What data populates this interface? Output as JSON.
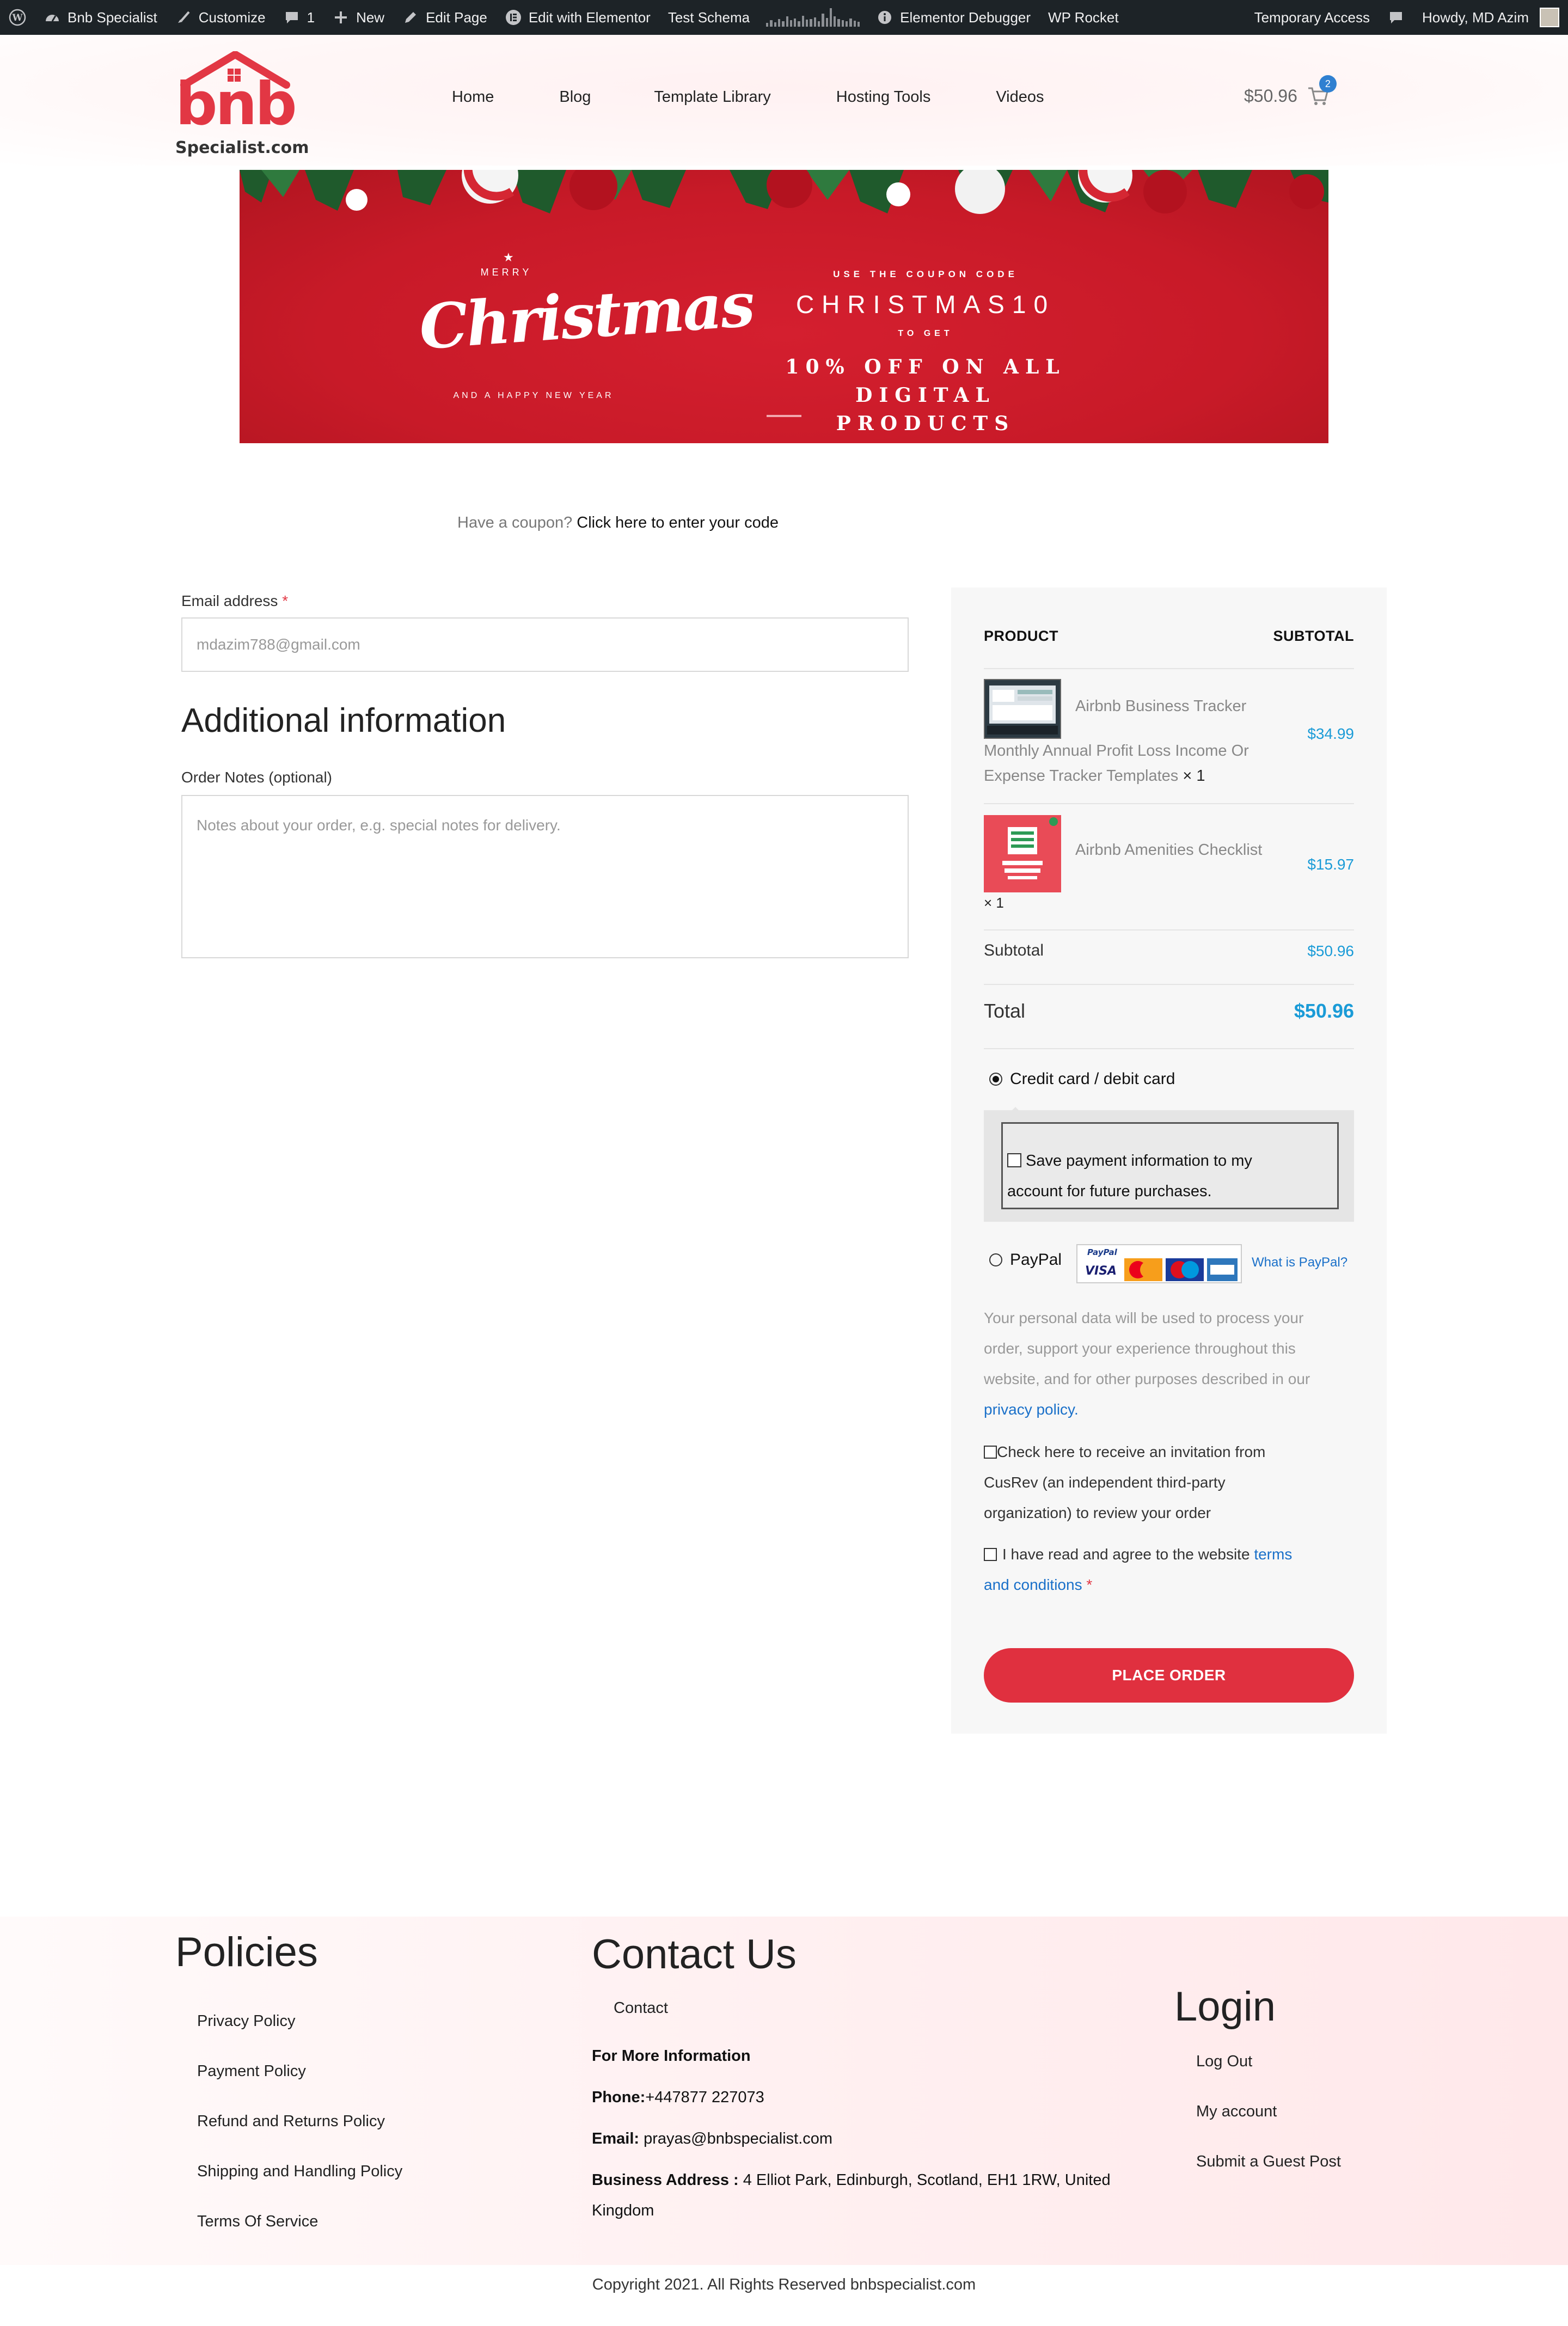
{
  "admin_bar": {
    "site_name": "Bnb Specialist",
    "customize": "Customize",
    "comments_count": "1",
    "new": "New",
    "edit_page": "Edit Page",
    "edit_elementor": "Edit with Elementor",
    "test_schema": "Test Schema",
    "elementor_debugger": "Elementor Debugger",
    "wp_rocket": "WP Rocket",
    "temporary_access": "Temporary Access",
    "howdy": "Howdy, MD Azim"
  },
  "header": {
    "logo_text": "bnb",
    "logo_sub": "Specialist.com",
    "nav": [
      "Home",
      "Blog",
      "Template Library",
      "Hosting Tools",
      "Videos"
    ],
    "cart_total": "$50.96",
    "cart_count": "2"
  },
  "banner": {
    "merry": "MERRY",
    "christmas": "Christmas",
    "new_year": "AND A HAPPY NEW YEAR",
    "use_code": "USE THE COUPON CODE",
    "code": "CHRISTMAS10",
    "to_get": "TO GET",
    "offer_line1": "10% OFF ON ALL DIGITAL",
    "offer_line2": "PRODUCTS"
  },
  "coupon": {
    "prompt": "Have a coupon?",
    "link": "Click here to enter your code"
  },
  "form": {
    "email_label": "Email address",
    "required_mark": "*",
    "email_value": "mdazim788@gmail.com",
    "additional_title": "Additional information",
    "notes_label": "Order Notes (optional)",
    "notes_placeholder": "Notes about your order, e.g. special notes for delivery."
  },
  "order": {
    "col_product": "PRODUCT",
    "col_subtotal": "SUBTOTAL",
    "items": [
      {
        "name_line1": "Airbnb Business Tracker",
        "name_line2": "Monthly Annual Profit Loss Income Or",
        "name_line3": "Expense Tracker Templates",
        "qty": "× 1",
        "price": "$34.99"
      },
      {
        "name_line1": "Airbnb Amenities Checklist",
        "qty": "× 1",
        "price": "$15.97"
      }
    ],
    "subtotal_label": "Subtotal",
    "subtotal_value": "$50.96",
    "total_label": "Total",
    "total_value": "$50.96",
    "payment_card": "Credit card / debit card",
    "save_payment_line1": "Save payment information to my",
    "save_payment_line2": "account for future purchases.",
    "payment_paypal": "PayPal",
    "what_is_paypal": "What is PayPal?",
    "privacy_line1": "Your personal data will be used to process your",
    "privacy_line2": "order, support your experience throughout this",
    "privacy_line3": "website, and for other purposes described in our",
    "privacy_link": "privacy policy",
    "privacy_period": ".",
    "cusrev_line1": "Check here to receive an invitation from",
    "cusrev_line2": "CusRev (an independent third-party",
    "cusrev_line3": "organization) to review your order",
    "terms_text": "I have read and agree to the website",
    "terms_link1": "terms",
    "terms_link2": "and conditions",
    "place_order": "PLACE ORDER"
  },
  "footer": {
    "policies_title": "Policies",
    "policies": [
      "Privacy Policy",
      "Payment Policy",
      "Refund and Returns Policy",
      "Shipping and Handling Policy",
      "Terms Of Service"
    ],
    "contact_title": "Contact Us",
    "contact_link": "Contact",
    "more_info": "For More Information",
    "phone_label": "Phone:",
    "phone_value": "+447877 227073",
    "email_label": "Email:",
    "email_value": " prayas@bnbspecialist.com",
    "address_label": "Business Address :",
    "address_line1": " 4 Elliot Park, Edinburgh, Scotland, EH1 1RW, United",
    "address_line2": "Kingdom",
    "login_title": "Login",
    "login_links": [
      "Log Out",
      "My account",
      "Submit a Guest Post"
    ],
    "copyright": "Copyright 2021. All Rights Reserved bnbspecialist.com"
  },
  "colors": {
    "brand_red": "#e23744",
    "button_red": "#e0303f",
    "price_blue": "#1a9bd7",
    "admin_bar": "#1d2327"
  }
}
